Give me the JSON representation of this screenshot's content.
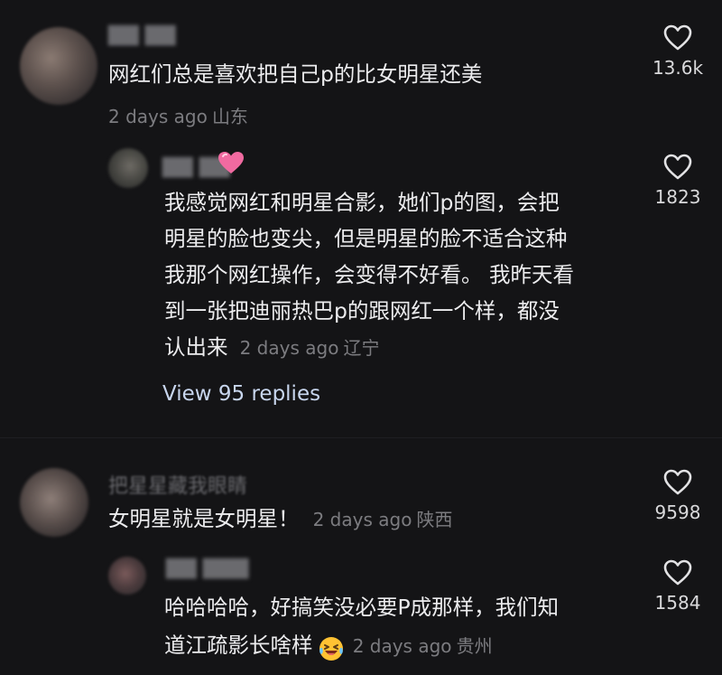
{
  "comments": [
    {
      "username": "▇▇ ▇▇",
      "text": "网红们总是喜欢把自己p的比女明星还美",
      "time": "2 days ago",
      "location": "山东",
      "likes": "13.6k"
    },
    {
      "username": "▇▇ ▇▇",
      "text_lines": [
        "我感觉网红和明星合影，她们p的图，会把",
        "明星的脸也变尖，但是明星的脸不适合这种",
        "我那个网红操作，会变得不好看。 我昨天看",
        "到一张把迪丽热巴p的跟网红一个样，都没",
        "认出来"
      ],
      "time": "2 days ago",
      "location": "辽宁",
      "likes": "1823",
      "view_replies": "View 95 replies"
    },
    {
      "username": "把星星藏我眼睛",
      "text": "女明星就是女明星！",
      "time": "2 days ago",
      "location": "陕西",
      "likes": "9598"
    },
    {
      "username": "▇▇ ▇▇▇",
      "text_lines": [
        "哈哈哈哈，好搞笑没必要P成那样，我们知",
        "道江疏影长啥样"
      ],
      "time": "2 days ago",
      "location": "贵州",
      "likes": "1584"
    }
  ],
  "icons": {
    "like": "heart-outline-icon",
    "reaction_heart": "pink-heart-emoji",
    "laugh_emoji": "laughing-crying-emoji"
  },
  "colors": {
    "background": "#141416",
    "text": "#ececee",
    "meta": "#7c7c80",
    "link": "#c8d6ee",
    "pink_heart": "#f06aa0"
  }
}
